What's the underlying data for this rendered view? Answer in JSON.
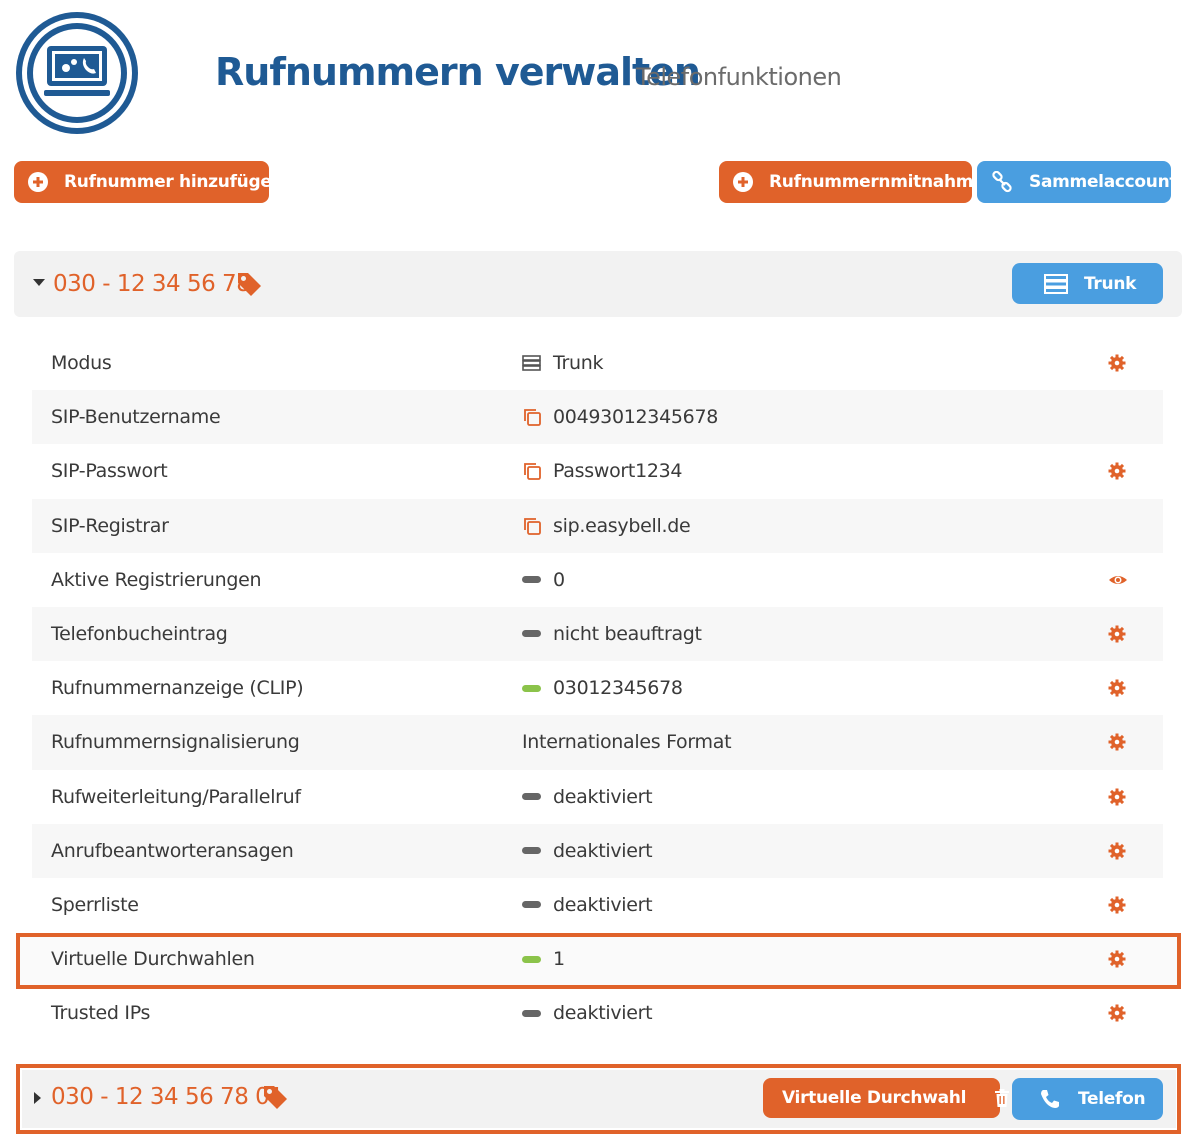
{
  "header": {
    "title": "Rufnummern verwalten",
    "subtitle": "Telefonfunktionen",
    "logo_icon": "computer-phone-icon"
  },
  "toolbar": {
    "add_label": "Rufnummer hinzufügen",
    "port_label": "Rufnummernmitnahme",
    "collect_label": "Sammelaccount"
  },
  "number_block": {
    "number": "030 - 12 34 56 78",
    "mode_button": "Trunk",
    "rows": [
      {
        "label": "Modus",
        "value": "Trunk",
        "value_icon": "server-icon",
        "action": "gear-icon"
      },
      {
        "label": "SIP-Benutzername",
        "value": "00493012345678",
        "value_icon": "copy-icon",
        "action": ""
      },
      {
        "label": "SIP-Passwort",
        "value": "Passwort1234",
        "value_icon": "copy-icon",
        "action": "gear-icon"
      },
      {
        "label": "SIP-Registrar",
        "value": "sip.easybell.de",
        "value_icon": "copy-icon",
        "action": ""
      },
      {
        "label": "Aktive Registrierungen",
        "value": "0",
        "value_icon": "status-grey",
        "action": "eye-icon"
      },
      {
        "label": "Telefonbucheintrag",
        "value": "nicht beauftragt",
        "value_icon": "status-grey",
        "action": "gear-icon"
      },
      {
        "label": "Rufnummernanzeige (CLIP)",
        "value": "03012345678",
        "value_icon": "status-green",
        "action": "gear-icon"
      },
      {
        "label": "Rufnummernsignalisierung",
        "value": "Internationales Format",
        "value_icon": "",
        "action": "gear-icon"
      },
      {
        "label": "Rufweiterleitung/Parallelruf",
        "value": "deaktiviert",
        "value_icon": "status-grey",
        "action": "gear-icon"
      },
      {
        "label": "Anrufbeantworteransagen",
        "value": "deaktiviert",
        "value_icon": "status-grey",
        "action": "gear-icon"
      },
      {
        "label": "Sperrliste",
        "value": "deaktiviert",
        "value_icon": "status-grey",
        "action": "gear-icon"
      },
      {
        "label": "Virtuelle Durchwahlen",
        "value": "1",
        "value_icon": "status-green",
        "action": "gear-icon"
      },
      {
        "label": "Trusted IPs",
        "value": "deaktiviert",
        "value_icon": "status-grey",
        "action": "gear-icon"
      }
    ]
  },
  "sub_block": {
    "number": "030 - 12 34 56 78 01",
    "vd_button": "Virtuelle Durchwahl",
    "tel_button": "Telefon"
  },
  "colors": {
    "accent_orange": "#e0622a",
    "accent_blue": "#4a9ee0",
    "title_blue": "#1f5a94",
    "status_green": "#8bc34a",
    "status_grey": "#666666"
  }
}
